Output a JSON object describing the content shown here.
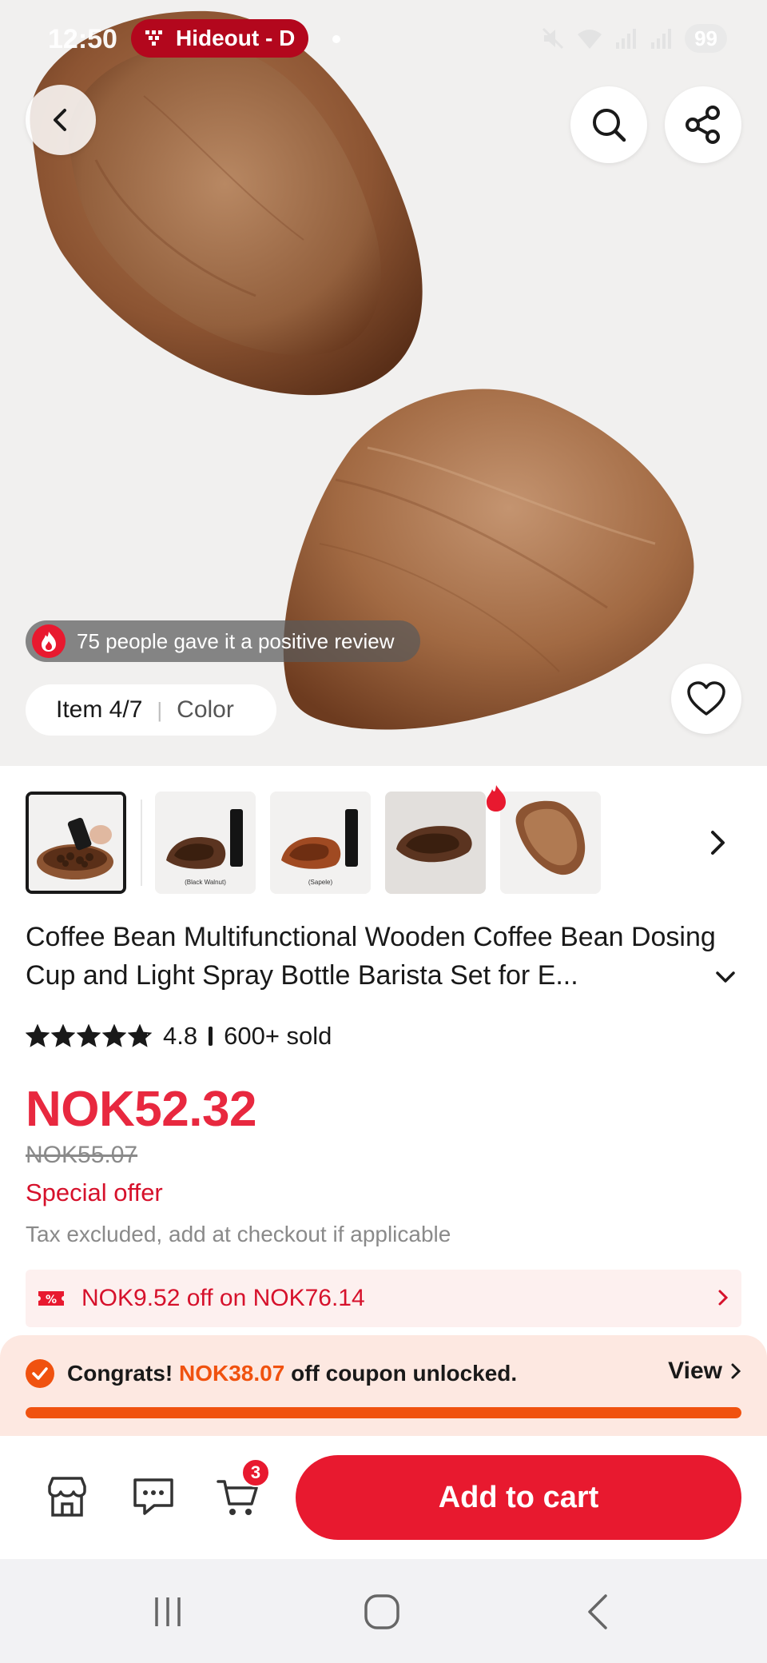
{
  "status_bar": {
    "time": "12:50",
    "music_app_label": "Hideout - D",
    "battery_level": "99"
  },
  "hero": {
    "review_text": "75 people gave it a positive review",
    "item_counter": "Item 4/7",
    "color_label": "Color"
  },
  "icons": {
    "back": "chevron-left-icon",
    "search": "search-icon",
    "share": "share-icon",
    "wishlist": "heart-outline-icon",
    "thumbnails_next": "chevron-right-icon",
    "hot": "flame-icon"
  },
  "thumbnails": [
    {
      "caption": ""
    },
    {
      "caption": "(Black Walnut)"
    },
    {
      "caption": "(Sapele)"
    },
    {
      "caption": ""
    },
    {
      "caption": ""
    }
  ],
  "product": {
    "title": "Coffee Bean Multifunctional Wooden Coffee Bean Dosing Cup and Light Spray Bottle Barista Set for E...",
    "rating": "4.8",
    "stars_fraction": 0.96,
    "sold": "600+ sold",
    "price": "NOK52.32",
    "original_price": "NOK55.07",
    "special_offer": "Special offer",
    "tax_note": "Tax excluded, add at checkout if applicable"
  },
  "coupon": {
    "text": "NOK9.52 off on NOK76.14"
  },
  "congrats": {
    "prefix": "Congrats!",
    "amount": "NOK38.07",
    "suffix": "off coupon unlocked.",
    "view_label": "View",
    "progress_fraction": 1.0
  },
  "action_bar": {
    "cart_count": "3",
    "add_to_cart_label": "Add to cart"
  },
  "colors": {
    "brand_red": "#e8192f",
    "price_red": "#e8283f",
    "orange": "#f0520f"
  }
}
